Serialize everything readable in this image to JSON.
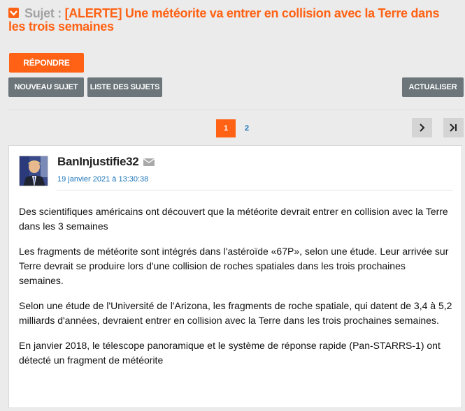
{
  "topic": {
    "prefix": "Sujet : ",
    "title": "[ALERTE] Une météorite va entrer en collision avec la Terre dans les trois semaines"
  },
  "toolbar": {
    "reply_label": "RÉPONDRE",
    "new_topic_label": "NOUVEAU SUJET",
    "topic_list_label": "LISTE DES SUJETS",
    "refresh_label": "ACTUALISER"
  },
  "pagination": {
    "current": "1",
    "pages": [
      "1",
      "2"
    ]
  },
  "post": {
    "author": "BanInjustifie32",
    "date": "19 janvier 2021 à 13:30:38",
    "paragraphs": [
      "Des scientifiques américains ont découvert que la météorite devrait entrer en collision avec la Terre dans les 3 semaines",
      "Les fragments de météorite sont intégrés dans l'astéroïde «67P», selon une étude. Leur arrivée sur Terre devrait se produire lors d'une collision de roches spatiales dans les trois prochaines semaines.",
      "Selon une étude de l'Université de l'Arizona, les fragments de roche spatiale, qui datent de 3,4 à 5,2 milliards d'années, devraient entrer en collision avec la Terre dans les trois prochaines semaines.",
      "En janvier 2018, le télescope panoramique et le système de réponse rapide (Pan-STARRS-1) ont détecté un fragment de météorite"
    ]
  },
  "colors": {
    "accent": "#ff6214",
    "button_grey": "#6b757a",
    "link": "#1a73b8",
    "background": "#ebebeb"
  },
  "icons": [
    "chevron-down-icon",
    "mail-icon",
    "chevron-right-icon",
    "last-page-icon"
  ]
}
